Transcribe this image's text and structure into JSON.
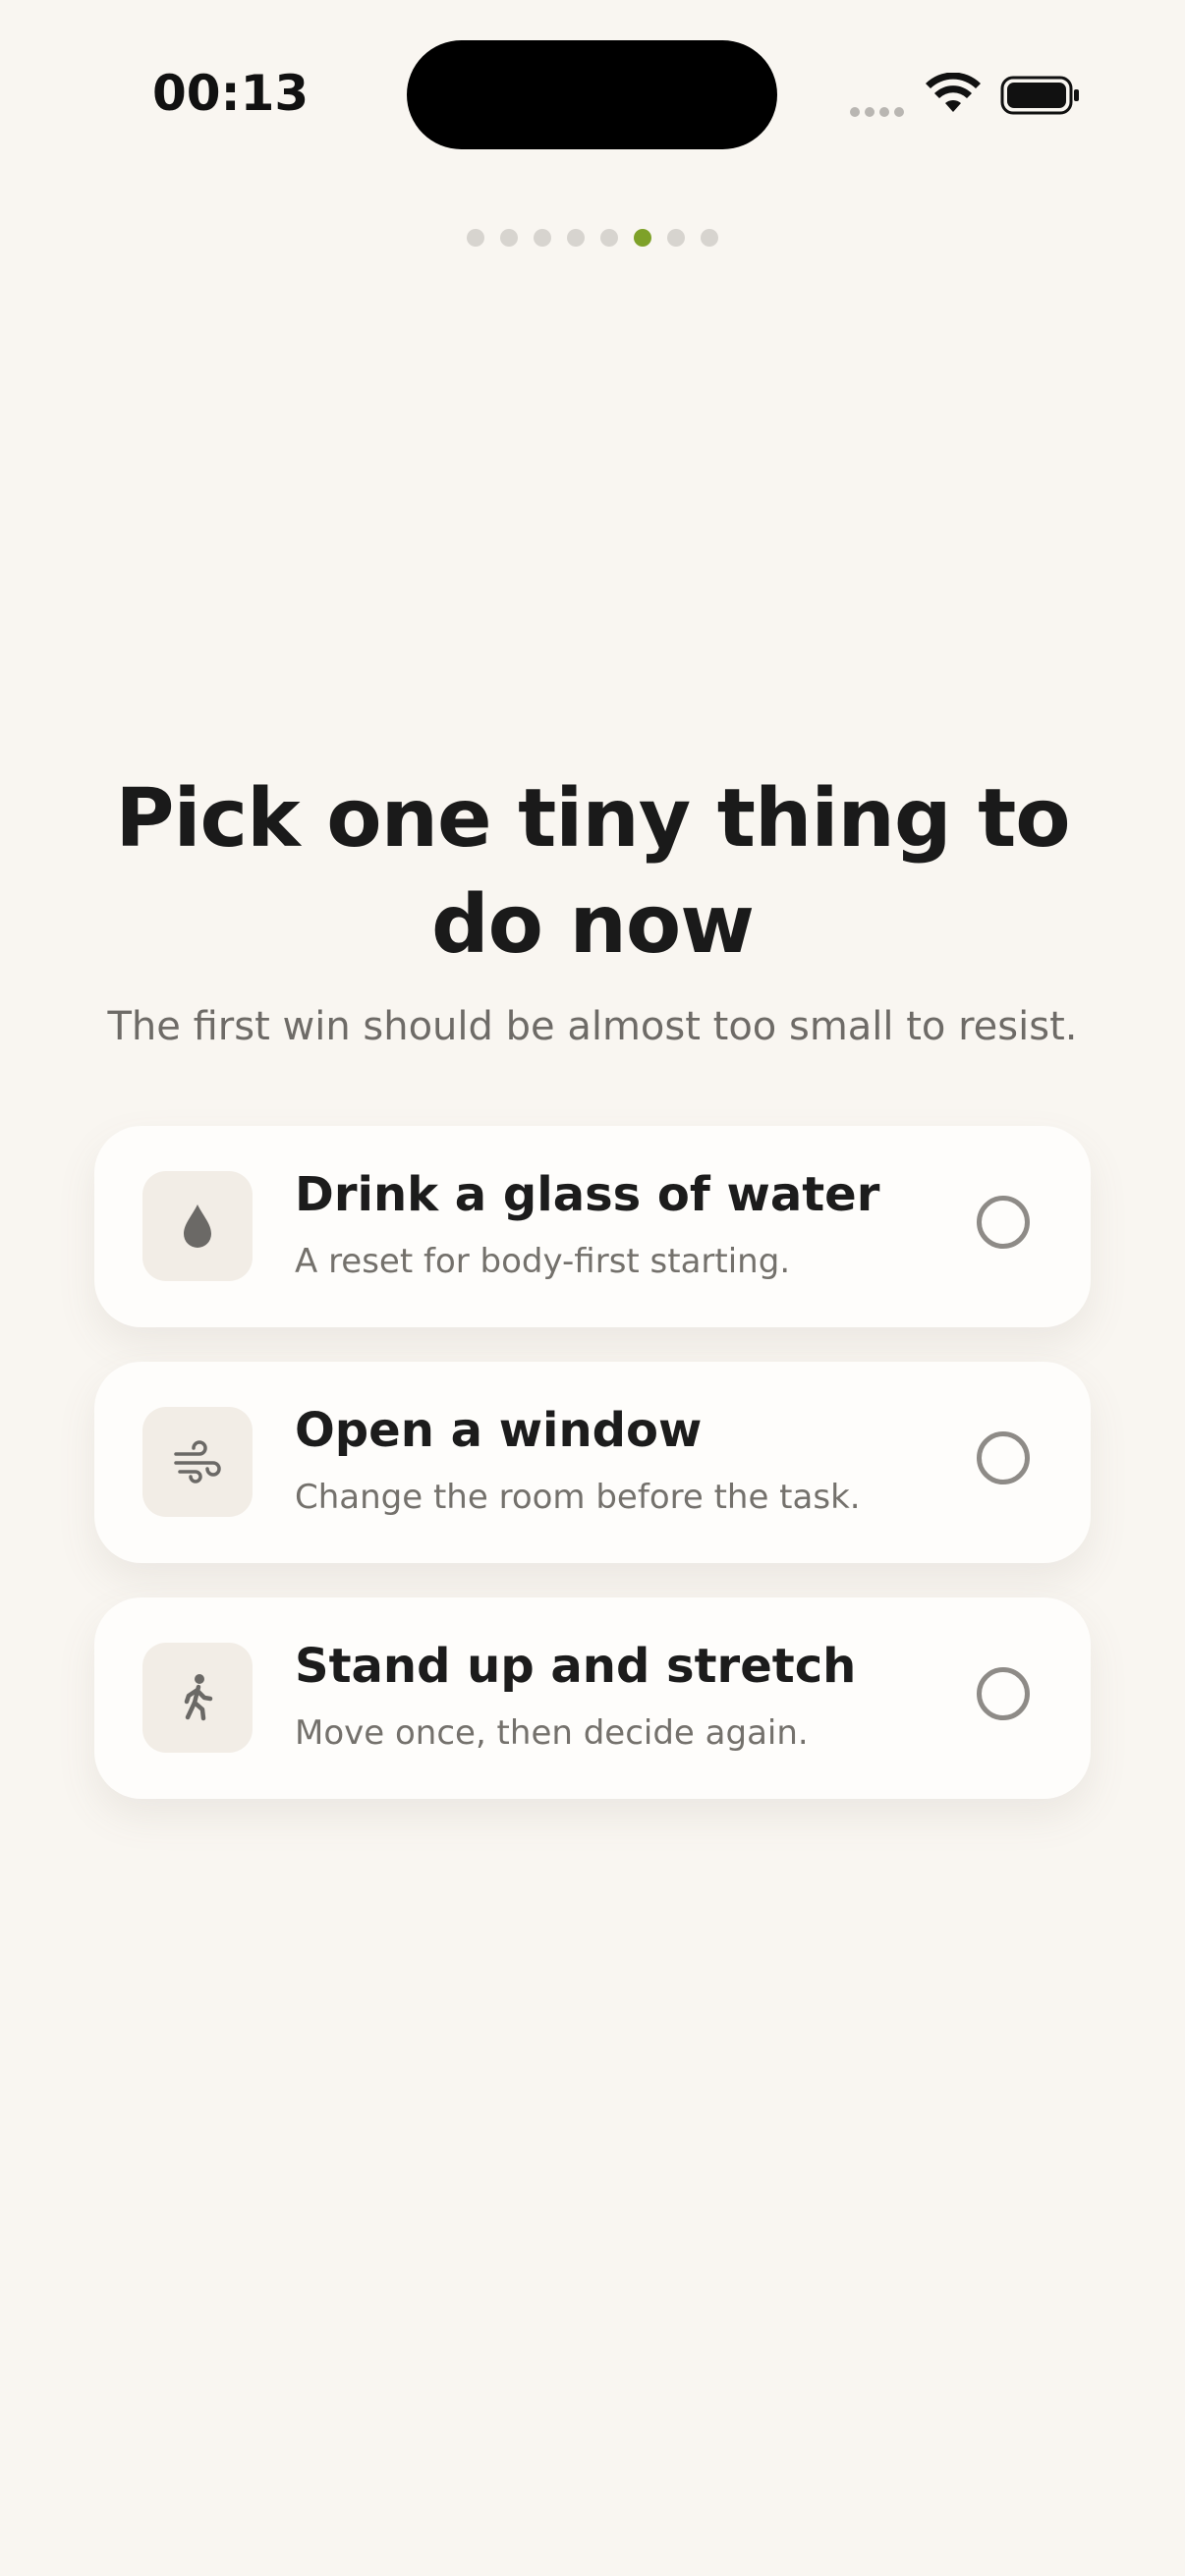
{
  "status_bar": {
    "time": "00:13",
    "icons": [
      "cellular-signal-icon",
      "wifi-icon",
      "battery-icon"
    ]
  },
  "progress": {
    "total_steps": 8,
    "current_step": 6,
    "active_color": "#7ea129",
    "inactive_color": "#d7d4cf"
  },
  "heading": {
    "title_line1": "Pick one tiny thing to",
    "title_line2": "do now",
    "subtitle": "The first win should be almost too small to resist."
  },
  "options": [
    {
      "icon": "water-drop-icon",
      "title": "Drink a glass of water",
      "subtitle": "A reset for body-first starting.",
      "selected": false
    },
    {
      "icon": "wind-icon",
      "title": "Open a window",
      "subtitle": "Change the room before the task.",
      "selected": false
    },
    {
      "icon": "walking-person-icon",
      "title": "Stand up and stretch",
      "subtitle": "Move once, then decide again.",
      "selected": false
    }
  ],
  "colors": {
    "background": "#f9f6f1",
    "card": "#fefdfb",
    "icon_tile": "#f2ede6",
    "radio_border": "#8e8b87"
  }
}
